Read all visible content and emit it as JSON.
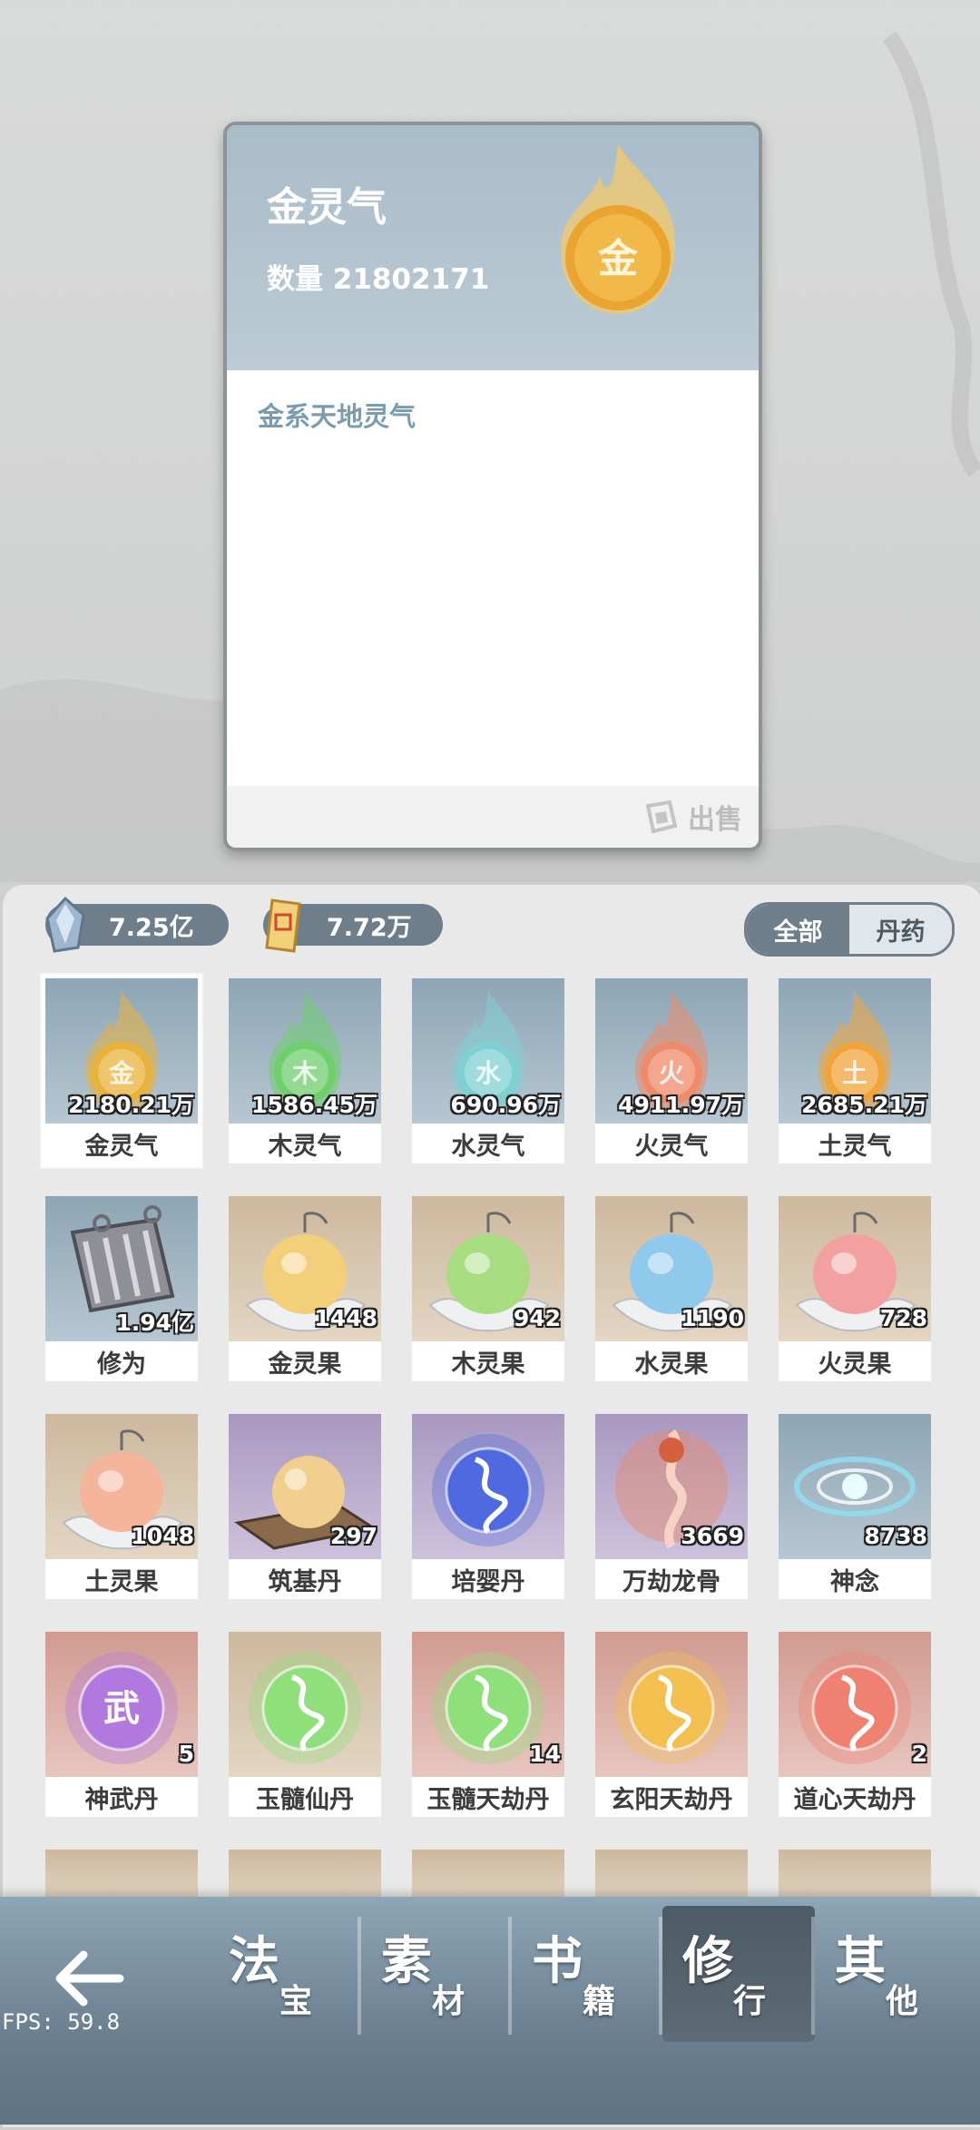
{
  "detail": {
    "title": "金灵气",
    "quantity": "数量 21802171",
    "description": "金系天地灵气",
    "sell_label": "出售",
    "icon_char": "金"
  },
  "currencies": [
    {
      "name": "spirit-stone",
      "value": "7.25亿"
    },
    {
      "name": "talisman",
      "value": "7.72万"
    }
  ],
  "filter": {
    "all": "全部",
    "pill": "丹药"
  },
  "items": [
    {
      "name": "金灵气",
      "count": "2180.21万",
      "bg": "blue",
      "glyph": "金",
      "color": "#e9b23a",
      "kind": "qi"
    },
    {
      "name": "木灵气",
      "count": "1586.45万",
      "bg": "blue",
      "glyph": "木",
      "color": "#6fcf6b",
      "kind": "qi"
    },
    {
      "name": "水灵气",
      "count": "690.96万",
      "bg": "blue",
      "glyph": "水",
      "color": "#7fd0d3",
      "kind": "qi"
    },
    {
      "name": "火灵气",
      "count": "4911.97万",
      "bg": "blue",
      "glyph": "火",
      "color": "#ef8a6a",
      "kind": "qi"
    },
    {
      "name": "土灵气",
      "count": "2685.21万",
      "bg": "blue",
      "glyph": "土",
      "color": "#f0a53b",
      "kind": "qi"
    },
    {
      "name": "修为",
      "count": "1.94亿",
      "bg": "blue",
      "glyph": "",
      "color": "#7d7d85",
      "kind": "scroll"
    },
    {
      "name": "金灵果",
      "count": "1448",
      "bg": "tan",
      "glyph": "",
      "color": "#f3cf7a",
      "kind": "fruit"
    },
    {
      "name": "木灵果",
      "count": "942",
      "bg": "tan",
      "glyph": "",
      "color": "#a7dd80",
      "kind": "fruit"
    },
    {
      "name": "水灵果",
      "count": "1190",
      "bg": "tan",
      "glyph": "",
      "color": "#8fc9ec",
      "kind": "fruit"
    },
    {
      "name": "火灵果",
      "count": "728",
      "bg": "tan",
      "glyph": "",
      "color": "#f2a0a0",
      "kind": "fruit"
    },
    {
      "name": "土灵果",
      "count": "1048",
      "bg": "tan",
      "glyph": "",
      "color": "#f5b59a",
      "kind": "fruit"
    },
    {
      "name": "筑基丹",
      "count": "297",
      "bg": "purple",
      "glyph": "",
      "color": "#f0cf8f",
      "kind": "pill"
    },
    {
      "name": "培婴丹",
      "count": "",
      "bg": "purple",
      "glyph": "",
      "color": "#4f6ae0",
      "kind": "orb"
    },
    {
      "name": "万劫龙骨",
      "count": "3669",
      "bg": "purple",
      "glyph": "",
      "color": "#e88a6a",
      "kind": "bone"
    },
    {
      "name": "神念",
      "count": "8738",
      "bg": "blue",
      "glyph": "",
      "color": "#8fe0f5",
      "kind": "swirl"
    },
    {
      "name": "神武丹",
      "count": "5",
      "bg": "red",
      "glyph": "武",
      "color": "#b178e0",
      "kind": "orb"
    },
    {
      "name": "玉髓仙丹",
      "count": "",
      "bg": "tan",
      "glyph": "",
      "color": "#8fe07a",
      "kind": "orb"
    },
    {
      "name": "玉髓天劫丹",
      "count": "14",
      "bg": "red",
      "glyph": "",
      "color": "#8fe07a",
      "kind": "orb"
    },
    {
      "name": "玄阳天劫丹",
      "count": "",
      "bg": "red",
      "glyph": "",
      "color": "#f3c050",
      "kind": "orb"
    },
    {
      "name": "道心天劫丹",
      "count": "2",
      "bg": "red",
      "glyph": "",
      "color": "#f08070",
      "kind": "orb"
    }
  ],
  "nav": {
    "tabs": [
      {
        "big": "法",
        "small": "宝"
      },
      {
        "big": "素",
        "small": "材"
      },
      {
        "big": "书",
        "small": "籍"
      },
      {
        "big": "修",
        "small": "行"
      },
      {
        "big": "其",
        "small": "他"
      }
    ],
    "active_index": 3
  },
  "fps": "FPS: 59.8"
}
